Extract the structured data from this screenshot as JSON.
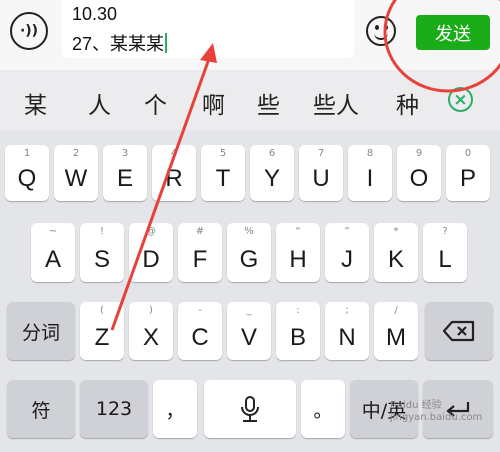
{
  "input": {
    "line1": "10.30",
    "line2": "27、某某某"
  },
  "send_label": "发送",
  "candidates": [
    "某",
    "人",
    "个",
    "啊",
    "些",
    "些人",
    "种"
  ],
  "icons": {
    "voice": "voice-wave-icon",
    "emoji": "smiley-icon",
    "clear": "clear-candidates-icon",
    "backspace": "backspace-icon",
    "mic": "microphone-icon",
    "enter": "enter-icon"
  },
  "row1": [
    {
      "main": "Q",
      "sub": "1"
    },
    {
      "main": "W",
      "sub": "2"
    },
    {
      "main": "E",
      "sub": "3"
    },
    {
      "main": "R",
      "sub": "4"
    },
    {
      "main": "T",
      "sub": "5"
    },
    {
      "main": "Y",
      "sub": "6"
    },
    {
      "main": "U",
      "sub": "7"
    },
    {
      "main": "I",
      "sub": "8"
    },
    {
      "main": "O",
      "sub": "9"
    },
    {
      "main": "P",
      "sub": "0"
    }
  ],
  "row2": [
    {
      "main": "A",
      "sub": "~"
    },
    {
      "main": "S",
      "sub": "!"
    },
    {
      "main": "D",
      "sub": "@"
    },
    {
      "main": "F",
      "sub": "#"
    },
    {
      "main": "G",
      "sub": "%"
    },
    {
      "main": "H",
      "sub": "“"
    },
    {
      "main": "J",
      "sub": "”"
    },
    {
      "main": "K",
      "sub": "*"
    },
    {
      "main": "L",
      "sub": "?"
    }
  ],
  "row3": [
    {
      "main": "Z",
      "sub": "("
    },
    {
      "main": "X",
      "sub": ")"
    },
    {
      "main": "C",
      "sub": "-"
    },
    {
      "main": "V",
      "sub": "_"
    },
    {
      "main": "B",
      "sub": ":"
    },
    {
      "main": "N",
      "sub": ";"
    },
    {
      "main": "M",
      "sub": "/"
    }
  ],
  "keys": {
    "segment": "分词",
    "symbol": "符",
    "num": "123",
    "comma": "，",
    "period": "。",
    "lang": "中/英"
  },
  "watermark": {
    "line1": "Baidu 经验",
    "line2": "jingyan.baidu.com"
  },
  "colors": {
    "accent": "#1aad19",
    "annotation": "#e8413a"
  }
}
